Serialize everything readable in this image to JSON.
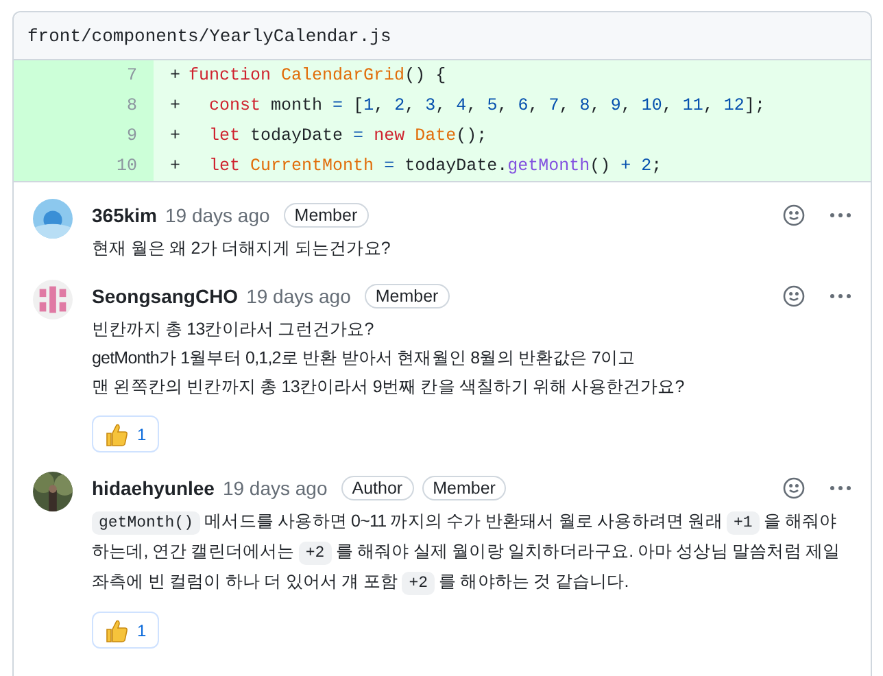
{
  "file": {
    "path": "front/components/YearlyCalendar.js"
  },
  "code_lines": [
    {
      "number": "7",
      "marker": "+",
      "tokens": [
        {
          "kind": "keyword",
          "text": "function"
        },
        {
          "kind": "entity",
          "text": " CalendarGrid"
        },
        {
          "kind": "plain",
          "text": "() {"
        }
      ]
    },
    {
      "number": "8",
      "marker": "+",
      "tokens": [
        {
          "kind": "keyword",
          "text": "  const"
        },
        {
          "kind": "plain",
          "text": " month "
        },
        {
          "kind": "number",
          "text": "="
        },
        {
          "kind": "plain",
          "text": " ["
        },
        {
          "kind": "number",
          "text": "1"
        },
        {
          "kind": "plain",
          "text": ", "
        },
        {
          "kind": "number",
          "text": "2"
        },
        {
          "kind": "plain",
          "text": ", "
        },
        {
          "kind": "number",
          "text": "3"
        },
        {
          "kind": "plain",
          "text": ", "
        },
        {
          "kind": "number",
          "text": "4"
        },
        {
          "kind": "plain",
          "text": ", "
        },
        {
          "kind": "number",
          "text": "5"
        },
        {
          "kind": "plain",
          "text": ", "
        },
        {
          "kind": "number",
          "text": "6"
        },
        {
          "kind": "plain",
          "text": ", "
        },
        {
          "kind": "number",
          "text": "7"
        },
        {
          "kind": "plain",
          "text": ", "
        },
        {
          "kind": "number",
          "text": "8"
        },
        {
          "kind": "plain",
          "text": ", "
        },
        {
          "kind": "number",
          "text": "9"
        },
        {
          "kind": "plain",
          "text": ", "
        },
        {
          "kind": "number",
          "text": "10"
        },
        {
          "kind": "plain",
          "text": ", "
        },
        {
          "kind": "number",
          "text": "11"
        },
        {
          "kind": "plain",
          "text": ", "
        },
        {
          "kind": "number",
          "text": "12"
        },
        {
          "kind": "plain",
          "text": "];"
        }
      ]
    },
    {
      "number": "9",
      "marker": "+",
      "tokens": [
        {
          "kind": "keyword",
          "text": "  let"
        },
        {
          "kind": "plain",
          "text": " todayDate "
        },
        {
          "kind": "number",
          "text": "="
        },
        {
          "kind": "keyword",
          "text": " new"
        },
        {
          "kind": "entity",
          "text": " Date"
        },
        {
          "kind": "plain",
          "text": "();"
        }
      ]
    },
    {
      "number": "10",
      "marker": "+",
      "tokens": [
        {
          "kind": "keyword",
          "text": "  let"
        },
        {
          "kind": "entity",
          "text": " CurrentMonth"
        },
        {
          "kind": "number",
          "text": " ="
        },
        {
          "kind": "plain",
          "text": " todayDate."
        },
        {
          "kind": "method",
          "text": "getMonth"
        },
        {
          "kind": "plain",
          "text": "() "
        },
        {
          "kind": "number",
          "text": "+ 2"
        },
        {
          "kind": "plain",
          "text": ";"
        }
      ]
    }
  ],
  "comments": [
    {
      "kind": "water",
      "author": "365kim",
      "time": "19 days ago",
      "badges": [
        "Member"
      ],
      "paragraphs": [
        [
          {
            "kind": "text",
            "text": "현재 월은 왜 2가 더해지게 되는건가요?"
          }
        ]
      ]
    },
    {
      "kind": "identicon",
      "author": "SeongsangCHO",
      "time": "19 days ago",
      "badges": [
        "Member"
      ],
      "paragraphs": [
        [
          {
            "kind": "text",
            "text": "빈칸까지 총 13칸이라서 그런건가요?"
          }
        ],
        [
          {
            "kind": "text",
            "text": "getMonth가 1월부터 0,1,2로 반환 받아서 현재월인 8월의 반환값은 7이고"
          }
        ],
        [
          {
            "kind": "text",
            "text": "맨 왼쪽칸의 빈칸까지 총 13칸이라서 9번째 칸을 색칠하기 위해 사용한건가요?"
          }
        ]
      ],
      "reactions": [
        {
          "count": "1"
        }
      ]
    },
    {
      "author": "hidaehyunlee",
      "time": "19 days ago",
      "badges": [
        "Author",
        "Member"
      ],
      "paragraphs": [
        [
          {
            "kind": "code",
            "text": "getMonth()"
          },
          {
            "kind": "text",
            "text": " 메서드를 사용하면 0~11 까지의 수가 반환돼서 월로 사용하려면 원래 "
          },
          {
            "kind": "code",
            "text": "+1"
          },
          {
            "kind": "text",
            "text": " 을 해줘야 하는데, 연간 캘린더에서는 "
          },
          {
            "kind": "code",
            "text": "+2"
          },
          {
            "kind": "text",
            "text": " 를 해줘야 실제 월이랑 일치하더라구요. 아마 성상님 말씀처럼 제일 좌측에 빈 컬럼이 하나 더 있어서 걔 포함 "
          },
          {
            "kind": "code",
            "text": "+2"
          },
          {
            "kind": "text",
            "text": " 를 해야하는 것 같습니다."
          }
        ]
      ],
      "reactions": [
        {
          "count": "1"
        }
      ]
    }
  ]
}
